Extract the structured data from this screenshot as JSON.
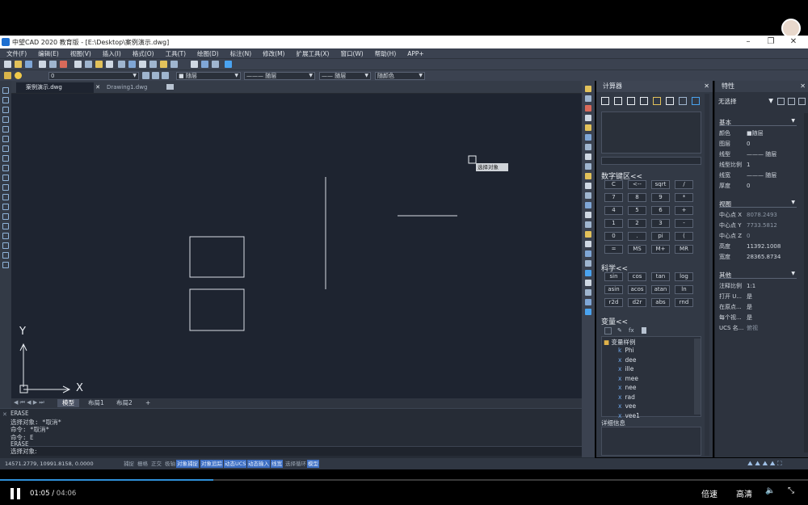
{
  "app": {
    "title": "中望CAD 2020 教育版 - [E:\\Desktop\\案例演示.dwg]"
  },
  "menu": [
    "文件(F)",
    "编辑(E)",
    "视图(V)",
    "插入(I)",
    "格式(O)",
    "工具(T)",
    "绘图(D)",
    "标注(N)",
    "修改(M)",
    "扩展工具(X)",
    "窗口(W)",
    "帮助(H)",
    "APP+"
  ],
  "toolbar": {
    "layer_combo": "0",
    "layer_select": "随层",
    "linetype": "随层",
    "lineweight": "随层",
    "plotstyle": "随颜色"
  },
  "doc_tabs": [
    "案例演示.dwg",
    "Drawing1.dwg"
  ],
  "canvas": {
    "tooltip": "选择对象",
    "axis_x": "X",
    "axis_y": "Y"
  },
  "layout_tabs": [
    "模型",
    "布局1",
    "布局2",
    "+"
  ],
  "command": {
    "lines": [
      "ERASE",
      "选择对象: *取消*",
      "命令: *取消*",
      "命令: E",
      "ERASE"
    ],
    "prompt": "选择对象:"
  },
  "status": {
    "coords": "14571.2779, 10991.8158, 0.0000",
    "buttons": [
      "捕捉",
      "栅格",
      "正交",
      "极轴",
      "对象捕捉",
      "对象追踪",
      "动态UCS",
      "动态输入",
      "线宽",
      "选择循环",
      "模型"
    ],
    "active": [
      "对象捕捉",
      "对象追踪",
      "动态UCS",
      "动态输入",
      "线宽",
      "模型"
    ]
  },
  "calc": {
    "title": "计算器",
    "numpad_title": "数字键区<<",
    "numpad": [
      "C",
      "<--",
      "sqrt",
      "/",
      "7",
      "8",
      "9",
      "*",
      "4",
      "5",
      "6",
      "+",
      "1",
      "2",
      "3",
      "-",
      "0",
      ".",
      "pi",
      "(",
      "=",
      "MS",
      "M+",
      "MR"
    ],
    "sci_title": "科学<<",
    "sci": [
      "sin",
      "cos",
      "tan",
      "log",
      "asin",
      "acos",
      "atan",
      "ln",
      "r2d",
      "d2r",
      "abs",
      "rnd"
    ],
    "var_title": "变量<<",
    "var_group": "变量样例",
    "vars": [
      {
        "t": "k",
        "n": "Phi"
      },
      {
        "t": "x",
        "n": "dee"
      },
      {
        "t": "x",
        "n": "ille"
      },
      {
        "t": "x",
        "n": "mee"
      },
      {
        "t": "x",
        "n": "nee"
      },
      {
        "t": "x",
        "n": "rad"
      },
      {
        "t": "x",
        "n": "vee"
      },
      {
        "t": "x",
        "n": "vee1"
      }
    ],
    "details": "详细信息"
  },
  "props": {
    "title": "特性",
    "selection": "无选择",
    "groups": [
      {
        "name": "基本",
        "rows": [
          [
            "颜色",
            "■随层"
          ],
          [
            "图层",
            "0"
          ],
          [
            "线型",
            "——— 随层"
          ],
          [
            "线型比例",
            "1"
          ],
          [
            "线宽",
            "——— 随层"
          ],
          [
            "厚度",
            "0"
          ]
        ]
      },
      {
        "name": "视图",
        "rows": [
          [
            "中心点 X",
            "8078.2493"
          ],
          [
            "中心点 Y",
            "7733.5812"
          ],
          [
            "中心点 Z",
            "0"
          ],
          [
            "高度",
            "11392.1008"
          ],
          [
            "宽度",
            "28365.8734"
          ]
        ]
      },
      {
        "name": "其他",
        "rows": [
          [
            "注释比例",
            "1:1"
          ],
          [
            "打开 U...",
            "是"
          ],
          [
            "在原点...",
            "是"
          ],
          [
            "每个视...",
            "是"
          ],
          [
            "UCS 名...",
            "俯视"
          ]
        ]
      }
    ]
  },
  "player": {
    "current": "01:05",
    "total": "04:06",
    "speed": "倍速",
    "quality": "高清",
    "progress": 0.264
  }
}
